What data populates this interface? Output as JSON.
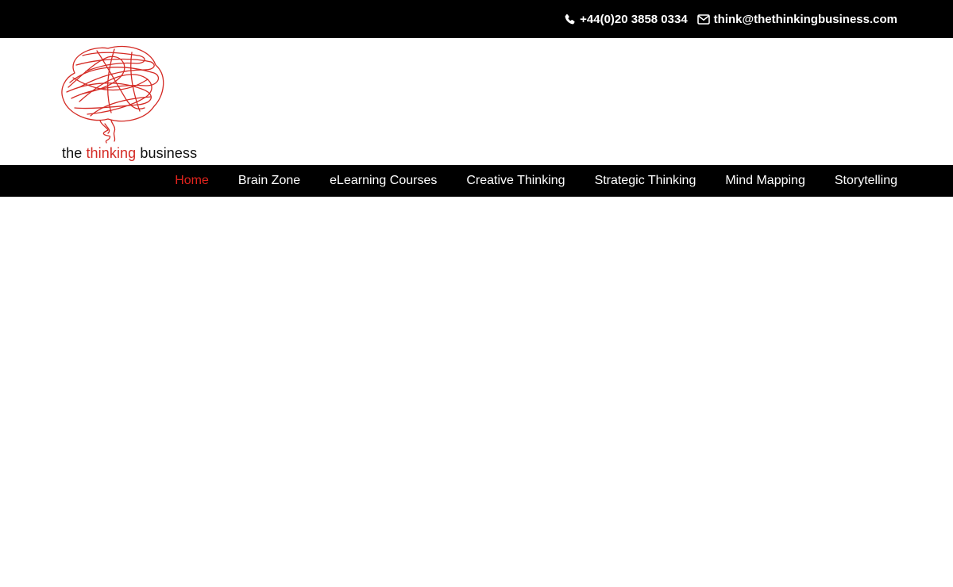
{
  "topbar": {
    "phone": "+44(0)20 3858 0334",
    "email": "think@thethinkingbusiness.com",
    "phone_icon": "phone-icon",
    "email_icon": "envelope-icon"
  },
  "logo": {
    "text_before": "the ",
    "text_accent": "thinking",
    "text_after": " business",
    "accent_color": "#d42a24"
  },
  "nav": {
    "items": [
      {
        "label": "Home",
        "active": true
      },
      {
        "label": "Brain Zone",
        "active": false
      },
      {
        "label": "eLearning Courses",
        "active": false
      },
      {
        "label": "Creative Thinking",
        "active": false
      },
      {
        "label": "Strategic Thinking",
        "active": false
      },
      {
        "label": "Mind Mapping",
        "active": false
      },
      {
        "label": "Storytelling",
        "active": false
      }
    ],
    "active_color": "#e0231d"
  }
}
